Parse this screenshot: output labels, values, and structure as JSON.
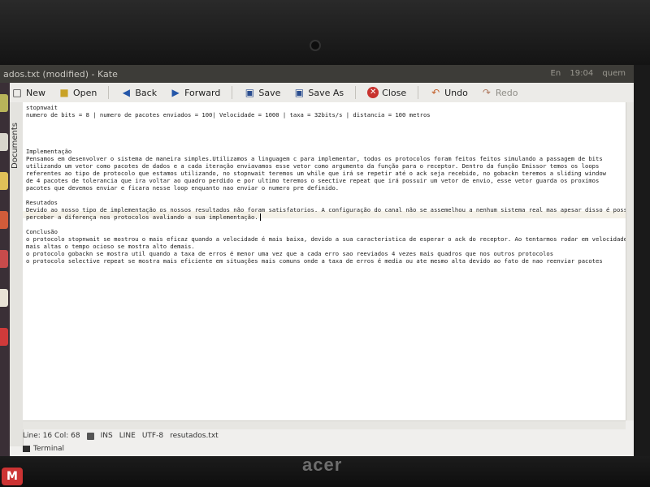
{
  "window": {
    "title": "ados.txt (modified) - Kate"
  },
  "panel": {
    "items": [
      "En",
      "19:04",
      "quem"
    ]
  },
  "toolbar": {
    "new_label": "New",
    "open_label": "Open",
    "back_label": "Back",
    "forward_label": "Forward",
    "save_label": "Save",
    "save_as_label": "Save As",
    "close_label": "Close",
    "undo_label": "Undo",
    "redo_label": "Redo"
  },
  "side_panel": {
    "documents_label": "Documents"
  },
  "document": {
    "lines": [
      "stopnwait",
      "numero de bits = 8 | numero de pacotes enviados = 100| Velocidade = 1000 | taxa = 32bits/s | distancia = 100 metros",
      "",
      "",
      "",
      "",
      "Implementação",
      "Pensamos em desenvolver o sistema de maneira simples.Utilizamos a linguagem c para implementar, todos os protocolos foram feitos feitos simulando a passagem de bits",
      "utilizando um vetor como pacotes de dados e a cada iteração enviavamos esse vetor como argumento da função para o receptor. Dentro da função Emissor temos os loops",
      "referentes ao tipo de protocolo que estamos utilizando, no stopnwait teremos um while que irá se repetir até o ack seja recebido, no gobackn teremos a sliding window",
      "de 4 pacotes de tolerancia que ira voltar ao quadro perdido e por ultimo teremos o seective repeat que irá possuir um vetor de envio, esse vetor guarda os proximos",
      "pacotes que devemos enviar e ficara nesse loop enquanto nao enviar o numero pre definido.",
      "",
      "Resutados",
      "Devido ao nosso tipo de implementação os nossos resultados não foram satisfatorios. A configuração do canal não se assemelhou a nenhum sistema real mas apesar disso é possive",
      "perceber a diferença nos protocolos avaliando a sua implementação.",
      "",
      "Conclusão",
      "o protocolo stopnwait se mostrou o mais eficaz quando a velocidade é mais baixa, devido a sua caracteristica de esperar o ack do receptor. Ao tentarmos rodar em velocidades",
      "mais altas o tempo ocioso se mostra alto demais.",
      "o protocolo gobackn se mostra util quando a taxa de erros é menor uma vez que a cada erro sao reeviados 4 vezes mais quadros que nos outros protocolos",
      "o protocolo selective repeat se mostra mais eficiente em situações mais comuns onde a taxa de erros é media ou ate mesmo alta devido ao fato de nao reenviar pacotes"
    ]
  },
  "status": {
    "position": "Line: 16 Col: 68",
    "mode": "INS",
    "wrap": "LINE",
    "encoding": "UTF-8",
    "filename": "resutados.txt"
  },
  "terminal": {
    "label": "Terminal"
  },
  "brand": {
    "logo_text": "acer"
  },
  "colors": {
    "title_bar": "#3d3c38",
    "launcher": "#3a2f36",
    "editor_bg": "#ffffff"
  }
}
